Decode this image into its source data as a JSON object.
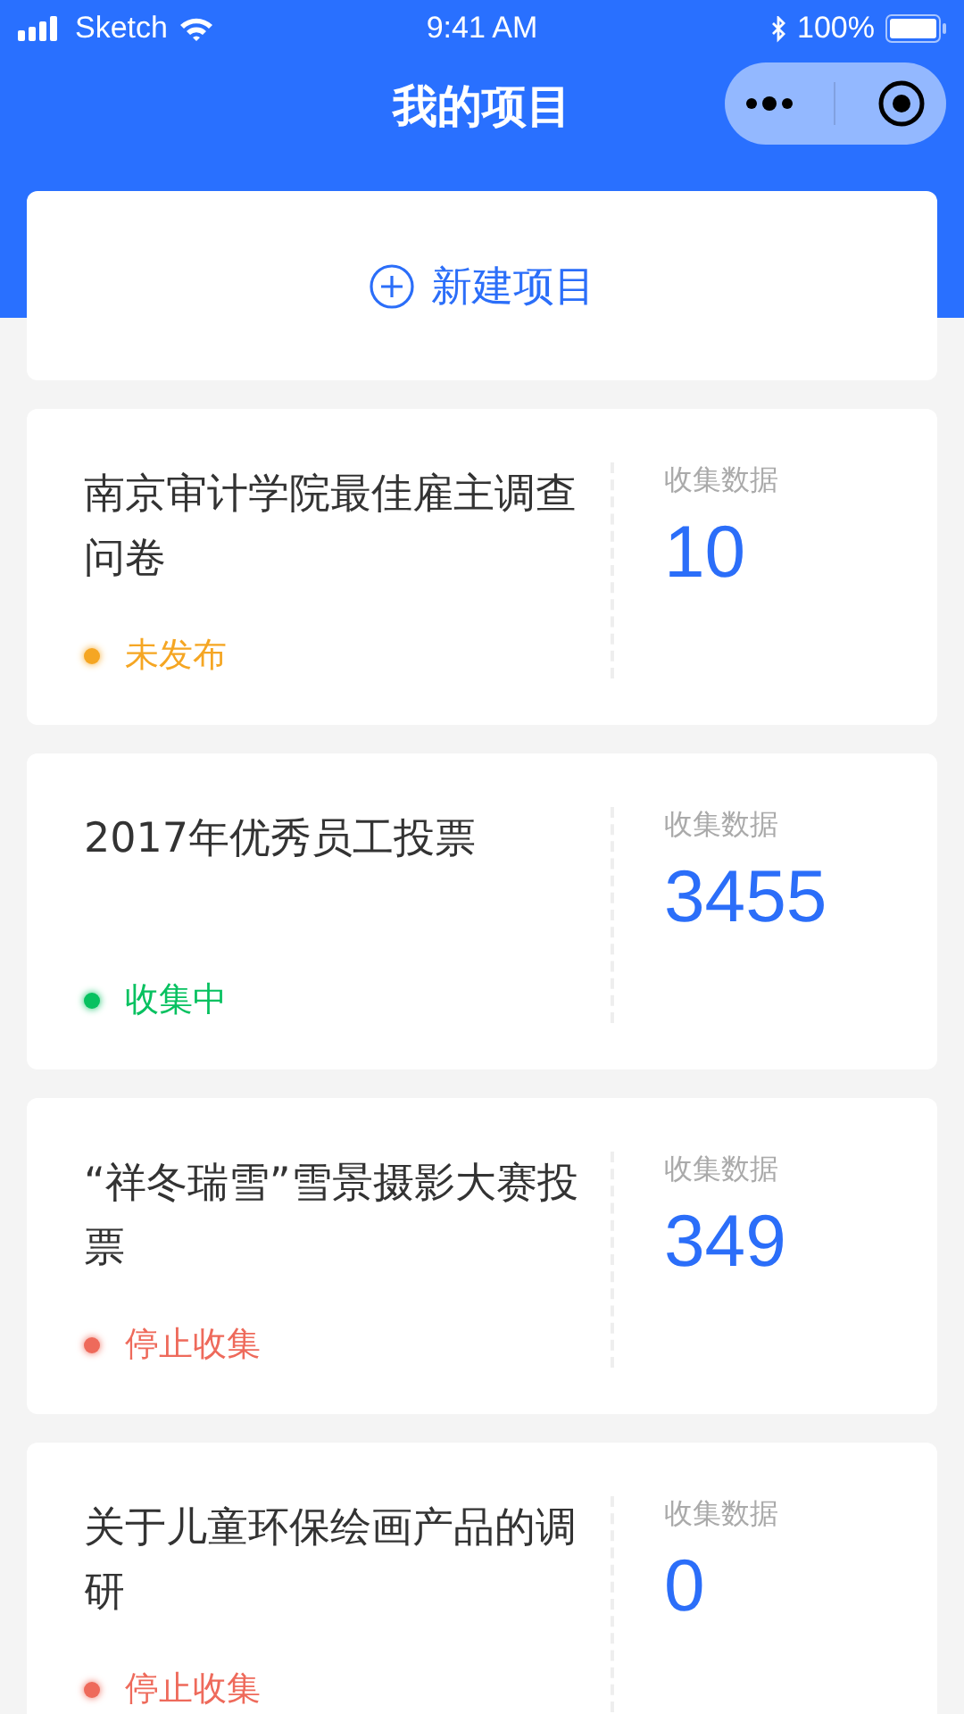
{
  "status_bar": {
    "carrier": "Sketch",
    "time": "9:41 AM",
    "battery": "100%"
  },
  "nav": {
    "title": "我的项目"
  },
  "new_project": {
    "label": "新建项目"
  },
  "projects": [
    {
      "title": "南京审计学院最佳雇主调查问卷",
      "status": "未发布",
      "color": "#f5a623",
      "count_label": "收集数据",
      "count": "10"
    },
    {
      "title": "2017年优秀员工投票",
      "status": "收集中",
      "color": "#07c160",
      "count_label": "收集数据",
      "count": "3455"
    },
    {
      "title": "“祥冬瑞雪”雪景摄影大赛投票",
      "status": "停止收集",
      "color": "#ee6a5b",
      "count_label": "收集数据",
      "count": "349"
    },
    {
      "title": "关于儿童环保绘画产品的调研",
      "status": "停止收集",
      "color": "#ee6a5b",
      "count_label": "收集数据",
      "count": "0"
    }
  ]
}
